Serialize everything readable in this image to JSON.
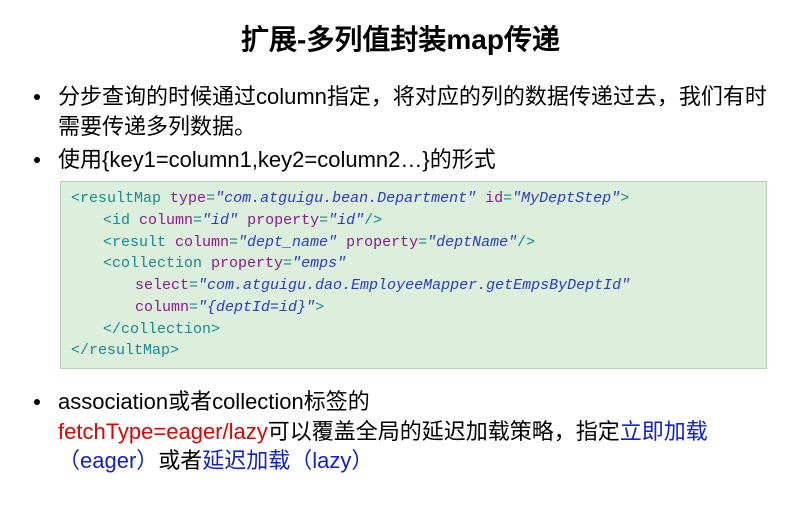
{
  "title": "扩展-多列值封装map传递",
  "bullets": {
    "b1": "分步查询的时候通过column指定，将对应的列的数据传递过去，我们有时需要传递多列数据。",
    "b2": "使用{key1=column1,key2=column2…}的形式",
    "b3_part1": "association或者collection标签的",
    "b3_red": "fetchType=eager/lazy",
    "b3_part2": "可以覆盖全局的延迟加载策略，指定",
    "b3_blue1": "立即加载（eager）",
    "b3_part3": "或者",
    "b3_blue2": "延迟加载（lazy）"
  },
  "code": {
    "l1": {
      "t1": "<resultMap ",
      "a1": "type",
      "eq": "=",
      "v1": "\"com.atguigu.bean.Department\"",
      "sp": " ",
      "a2": "id",
      "v2": "\"MyDeptStep\"",
      "t2": ">"
    },
    "l2": {
      "t1": "<id ",
      "a1": "column",
      "v1": "\"id\"",
      "sp": " ",
      "a2": "property",
      "v2": "\"id\"",
      "t2": "/>"
    },
    "l3": {
      "t1": "<result ",
      "a1": "column",
      "v1": "\"dept_name\"",
      "sp": " ",
      "a2": "property",
      "v2": "\"deptName\"",
      "t2": "/>"
    },
    "l4": {
      "t1": "<collection ",
      "a1": "property",
      "v1": "\"emps\""
    },
    "l5": {
      "a1": "select",
      "v1": "\"com.atguigu.dao.EmployeeMapper.getEmpsByDeptId\""
    },
    "l6": {
      "a1": "column",
      "v1": "\"{deptId=id}\"",
      "t2": ">"
    },
    "l7": {
      "t1": "</collection>"
    },
    "l8": {
      "t1": "</resultMap>"
    }
  }
}
